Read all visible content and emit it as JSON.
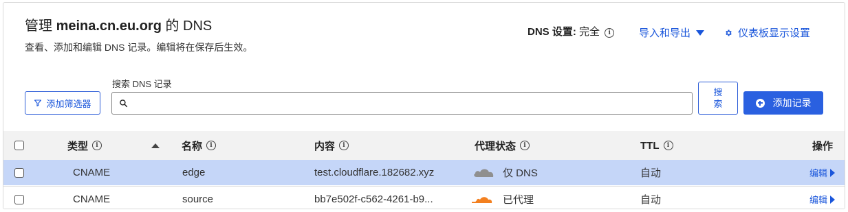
{
  "header": {
    "title_prefix": "管理 ",
    "domain": "meina.cn.eu.org",
    "title_suffix": " 的 DNS",
    "subtitle": "查看、添加和编辑 DNS 记录。编辑将在保存后生效。",
    "dns_setting_label": "DNS 设置:",
    "dns_setting_value": "完全",
    "import_export": "导入和导出",
    "dashboard_settings": "仪表板显示设置"
  },
  "toolbar": {
    "filter_button": "添加筛选器",
    "search_label": "搜索 DNS 记录",
    "search_value": "",
    "search_button": "搜索",
    "add_record_button": "添加记录"
  },
  "table": {
    "headers": {
      "type": "类型",
      "name": "名称",
      "content": "内容",
      "proxy": "代理状态",
      "ttl": "TTL",
      "actions": "操作"
    },
    "rows": [
      {
        "type": "CNAME",
        "name": "edge",
        "content": "test.cloudflare.182682.xyz",
        "proxy_status": "仅 DNS",
        "proxy_icon": "cloud-dns-only-icon",
        "ttl": "自动",
        "edit": "编辑",
        "highlighted": true
      },
      {
        "type": "CNAME",
        "name": "source",
        "content": "bb7e502f-c562-4261-b9...",
        "proxy_status": "已代理",
        "proxy_icon": "cloud-proxied-icon",
        "ttl": "自动",
        "edit": "编辑",
        "highlighted": false
      }
    ]
  },
  "colors": {
    "accent": "#1a56db",
    "primary_button": "#2a60e0",
    "highlight_row": "#c5d6f8",
    "cloud_gray": "#8f8f8f",
    "cloud_orange": "#f38020"
  }
}
